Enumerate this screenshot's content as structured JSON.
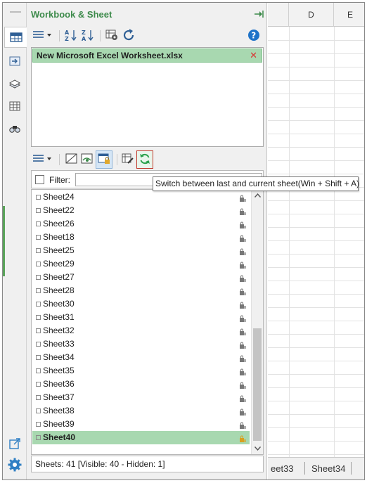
{
  "pane": {
    "title": "Workbook & Sheet"
  },
  "workbooks": [
    {
      "name": "New Microsoft Excel Worksheet.xlsx",
      "close": "✕"
    }
  ],
  "filter": {
    "label": "Filter:",
    "value": ""
  },
  "sheets": [
    {
      "name": "Sheet24",
      "selected": false
    },
    {
      "name": "Sheet22",
      "selected": false
    },
    {
      "name": "Sheet26",
      "selected": false
    },
    {
      "name": "Sheet18",
      "selected": false
    },
    {
      "name": "Sheet25",
      "selected": false
    },
    {
      "name": "Sheet29",
      "selected": false
    },
    {
      "name": "Sheet27",
      "selected": false
    },
    {
      "name": "Sheet28",
      "selected": false
    },
    {
      "name": "Sheet30",
      "selected": false
    },
    {
      "name": "Sheet31",
      "selected": false
    },
    {
      "name": "Sheet32",
      "selected": false
    },
    {
      "name": "Sheet33",
      "selected": false
    },
    {
      "name": "Sheet34",
      "selected": false
    },
    {
      "name": "Sheet35",
      "selected": false
    },
    {
      "name": "Sheet36",
      "selected": false
    },
    {
      "name": "Sheet37",
      "selected": false
    },
    {
      "name": "Sheet38",
      "selected": false
    },
    {
      "name": "Sheet39",
      "selected": false
    },
    {
      "name": "Sheet40",
      "selected": true
    }
  ],
  "status": {
    "text": "Sheets: 41  [Visible: 40 - Hidden: 1]"
  },
  "tooltip": {
    "text": "Switch between last and current sheet(Win + Shift + A)"
  },
  "spreadsheet": {
    "columns": [
      "D",
      "E"
    ],
    "tabs": [
      "eet33",
      "Sheet34"
    ]
  },
  "colors": {
    "accent_green": "#3c8a4a",
    "selected_row": "#a8d8b0",
    "close_red": "#d93333",
    "help_blue": "#1e73c8"
  },
  "icons": {
    "left_strip": [
      "workbook-sheet-icon",
      "navigation-icon",
      "layers-icon",
      "table-icon",
      "find-icon",
      "popout-icon",
      "gear-icon"
    ],
    "toolbar1": [
      "menu-icon",
      "sort-az-icon",
      "sort-za-icon",
      "sheet-settings-icon",
      "refresh-icon",
      "help-icon"
    ],
    "toolbar2": [
      "menu-icon",
      "hide-icon",
      "unhide-icon",
      "protect-icon",
      "edit-icon",
      "switch-sheet-icon"
    ]
  }
}
